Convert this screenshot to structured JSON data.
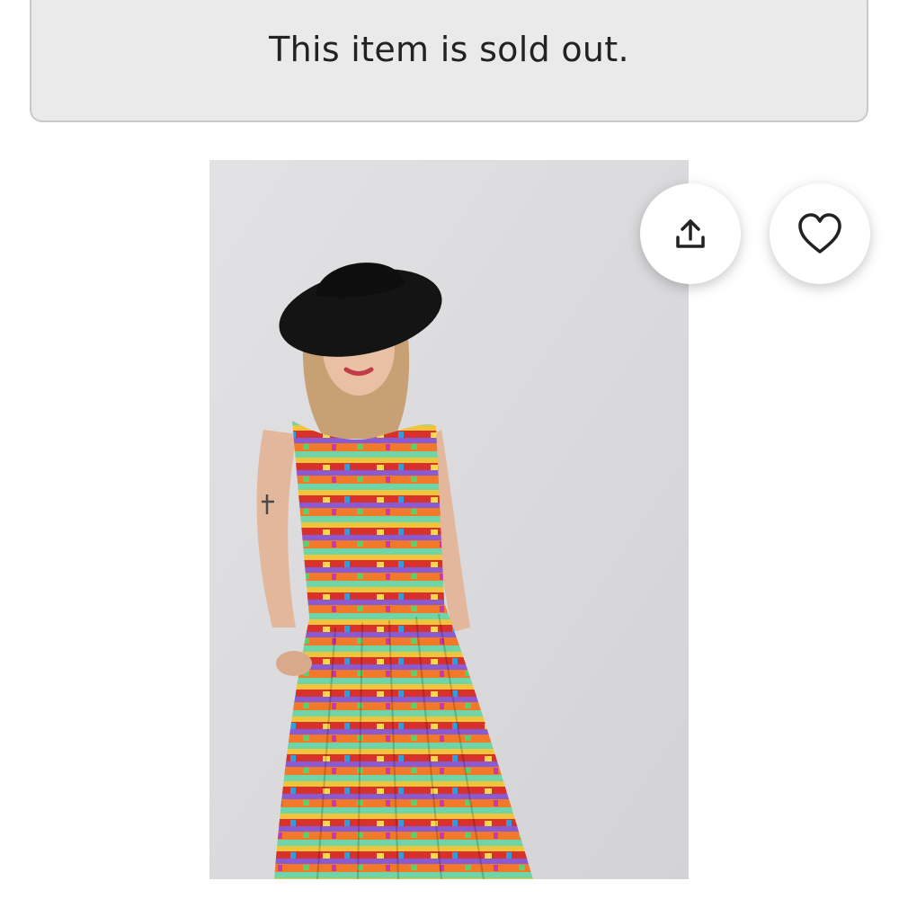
{
  "banner": {
    "message": "This item is sold out."
  },
  "listing_image": {
    "subject": "woman in black wide-brim hat wearing colorful printed sleeveless maxi dress"
  },
  "actions": {
    "share_icon": "share-upload-icon",
    "favorite_icon": "heart-outline-icon"
  },
  "colors": {
    "banner_bg": "#eaeaea",
    "banner_border": "#c9c9c9",
    "text": "#222222",
    "photo_bg": "#dcdcde"
  }
}
